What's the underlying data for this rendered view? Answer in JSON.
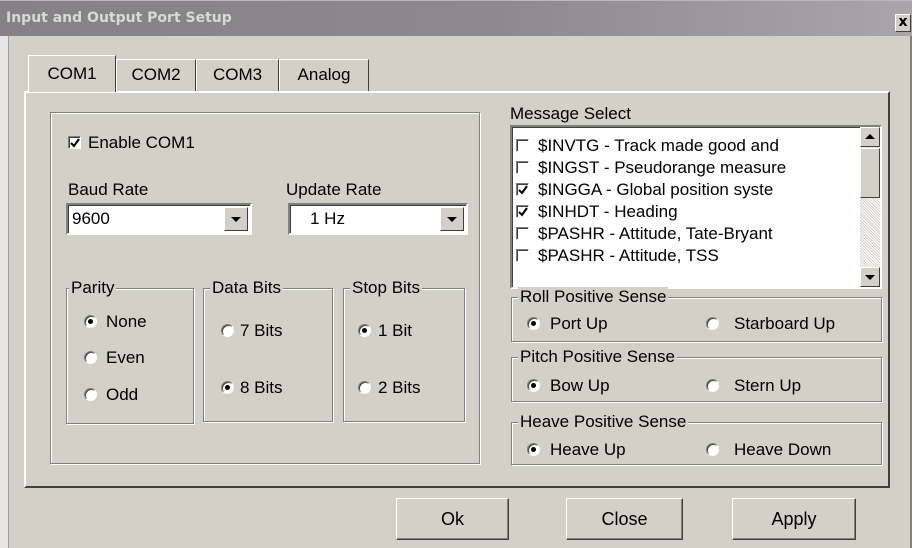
{
  "window": {
    "title": "Input and Output Port Setup",
    "close_label": "x"
  },
  "tabs": [
    {
      "label": "COM1",
      "active": true
    },
    {
      "label": "COM2",
      "active": false
    },
    {
      "label": "COM3",
      "active": false
    },
    {
      "label": "Analog",
      "active": false
    }
  ],
  "com1": {
    "enable_label": "Enable COM1",
    "enabled": true,
    "baud_rate": {
      "label": "Baud Rate",
      "value": "9600"
    },
    "update_rate": {
      "label": "Update Rate",
      "value": "1 Hz"
    },
    "parity": {
      "label": "Parity",
      "options": [
        {
          "label": "None",
          "selected": true
        },
        {
          "label": "Even",
          "selected": false
        },
        {
          "label": "Odd",
          "selected": false
        }
      ]
    },
    "data_bits": {
      "label": "Data Bits",
      "options": [
        {
          "label": "7 Bits",
          "selected": false
        },
        {
          "label": "8 Bits",
          "selected": true
        }
      ]
    },
    "stop_bits": {
      "label": "Stop Bits",
      "options": [
        {
          "label": "1 Bit",
          "selected": true
        },
        {
          "label": "2 Bits",
          "selected": false
        }
      ]
    }
  },
  "message_select": {
    "label": "Message Select",
    "items": [
      {
        "text": "$INVTG - Track made good and",
        "checked": false
      },
      {
        "text": "$INGST - Pseudorange measure",
        "checked": false
      },
      {
        "text": "$INGGA - Global position syste",
        "checked": true
      },
      {
        "text": "$INHDT - Heading",
        "checked": true
      },
      {
        "text": "$PASHR - Attitude, Tate-Bryant",
        "checked": false
      },
      {
        "text": "$PASHR - Attitude, TSS",
        "checked": false
      }
    ]
  },
  "roll_sense": {
    "label": "Roll Positive Sense",
    "options": [
      {
        "label": "Port Up",
        "selected": true
      },
      {
        "label": "Starboard Up",
        "selected": false
      }
    ]
  },
  "pitch_sense": {
    "label": "Pitch Positive Sense",
    "options": [
      {
        "label": "Bow Up",
        "selected": true
      },
      {
        "label": "Stern Up",
        "selected": false
      }
    ]
  },
  "heave_sense": {
    "label": "Heave Positive Sense",
    "options": [
      {
        "label": "Heave Up",
        "selected": true
      },
      {
        "label": "Heave Down",
        "selected": false
      }
    ]
  },
  "buttons": {
    "ok": "Ok",
    "close": "Close",
    "apply": "Apply"
  }
}
